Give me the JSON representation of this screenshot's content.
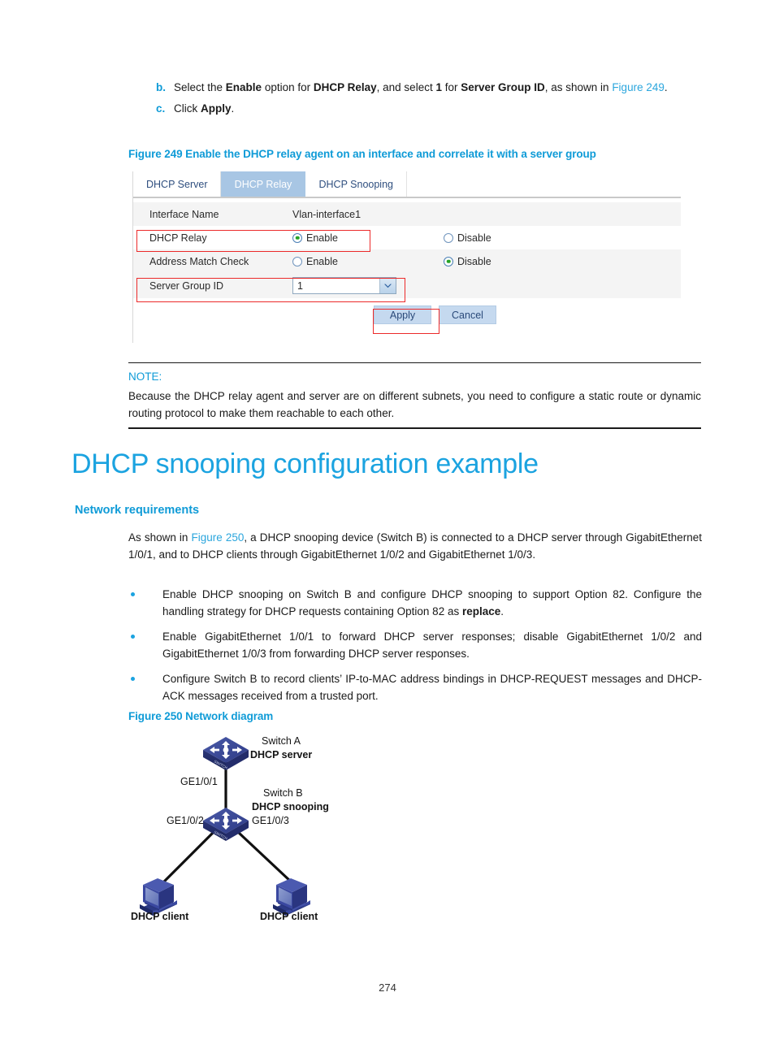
{
  "steps": [
    {
      "marker": "b.",
      "segments": [
        {
          "t": "Select the ",
          "s": "n"
        },
        {
          "t": "Enable",
          "s": "b"
        },
        {
          "t": " option for ",
          "s": "n"
        },
        {
          "t": "DHCP Relay",
          "s": "b"
        },
        {
          "t": ", and select ",
          "s": "n"
        },
        {
          "t": "1",
          "s": "b"
        },
        {
          "t": " for ",
          "s": "n"
        },
        {
          "t": "Server Group ID",
          "s": "b"
        },
        {
          "t": ", as shown in ",
          "s": "n"
        },
        {
          "t": "Figure 249",
          "s": "l"
        },
        {
          "t": ".",
          "s": "n"
        }
      ]
    },
    {
      "marker": "c.",
      "segments": [
        {
          "t": "Click ",
          "s": "n"
        },
        {
          "t": "Apply",
          "s": "b"
        },
        {
          "t": ".",
          "s": "n"
        }
      ]
    }
  ],
  "figure249": {
    "caption": "Figure 249 Enable the DHCP relay agent on an interface and correlate it with a server group",
    "tabs": [
      {
        "label": "DHCP Server",
        "active": false
      },
      {
        "label": "DHCP Relay",
        "active": true
      },
      {
        "label": "DHCP Snooping",
        "active": false
      }
    ],
    "rows": {
      "interface_name_label": "Interface Name",
      "interface_name_value": "Vlan-interface1",
      "dhcp_relay_label": "DHCP Relay",
      "dhcp_relay_enable": "Enable",
      "dhcp_relay_disable": "Disable",
      "dhcp_relay_selected": "Enable",
      "address_match_label": "Address Match Check",
      "address_match_enable": "Enable",
      "address_match_disable": "Disable",
      "address_match_selected": "Disable",
      "server_group_label": "Server Group ID",
      "server_group_value": "1"
    },
    "buttons": {
      "apply": "Apply",
      "cancel": "Cancel"
    },
    "highlight_color": "#ec2a2a",
    "active_tab_color": "#a8c6e4"
  },
  "note": {
    "title": "NOTE:",
    "text": "Because the DHCP relay agent and server are on different subnets, you need to configure a static route or dynamic routing protocol to make them reachable to each other."
  },
  "heading": "DHCP snooping configuration example",
  "subheading": "Network requirements",
  "intro": {
    "segments": [
      {
        "t": "As shown in ",
        "s": "n"
      },
      {
        "t": "Figure 250",
        "s": "l"
      },
      {
        "t": ", a DHCP snooping device (Switch B) is connected to a DHCP server through GigabitEthernet 1/0/1, and to DHCP clients through GigabitEthernet 1/0/2 and GigabitEthernet 1/0/3.",
        "s": "n"
      }
    ]
  },
  "bullets": [
    {
      "segments": [
        {
          "t": "Enable DHCP snooping on Switch B and configure DHCP snooping to support Option 82. Configure the handling strategy for DHCP requests containing Option 82 as ",
          "s": "n"
        },
        {
          "t": "replace",
          "s": "b"
        },
        {
          "t": ".",
          "s": "n"
        }
      ]
    },
    {
      "segments": [
        {
          "t": "Enable GigabitEthernet 1/0/1 to forward DHCP server responses; disable GigabitEthernet 1/0/2 and GigabitEthernet 1/0/3 from forwarding DHCP server responses.",
          "s": "n"
        }
      ]
    },
    {
      "segments": [
        {
          "t": "Configure Switch B to record clients’ IP-to-MAC address bindings in DHCP-REQUEST messages and DHCP-ACK messages received from a trusted port.",
          "s": "n"
        }
      ]
    }
  ],
  "figure250": {
    "caption": "Figure 250 Network diagram",
    "nodes": {
      "switch_a_name": "Switch A",
      "switch_a_role": "DHCP server",
      "switch_b_name": "Switch B",
      "switch_b_role": "DHCP snooping",
      "client_left": "DHCP client",
      "client_right": "DHCP client"
    },
    "links": {
      "ge1_0_1": "GE1/0/1",
      "ge1_0_2": "GE1/0/2",
      "ge1_0_3": "GE1/0/3"
    },
    "icon_label": "SWITCH"
  },
  "page_number": "274"
}
